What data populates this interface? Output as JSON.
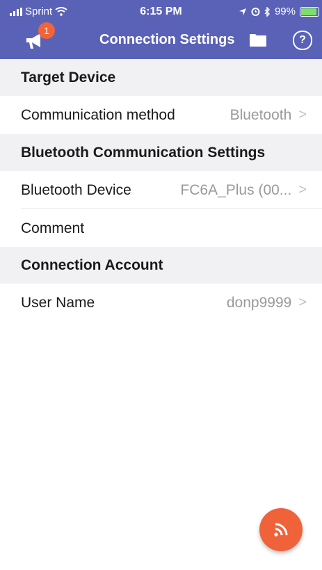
{
  "status_bar": {
    "carrier": "Sprint",
    "time": "6:15 PM",
    "battery": "99%"
  },
  "app_bar": {
    "title": "Connection Settings",
    "notification_count": "1",
    "help_label": "?"
  },
  "sections": {
    "target_device": {
      "header": "Target Device",
      "communication_method_label": "Communication method",
      "communication_method_value": "Bluetooth"
    },
    "bluetooth": {
      "header": "Bluetooth Communication Settings",
      "device_label": "Bluetooth Device",
      "device_value": "FC6A_Plus (00...",
      "comment_label": "Comment"
    },
    "account": {
      "header": "Connection Account",
      "user_name_label": "User Name",
      "user_name_value": "donp9999"
    }
  },
  "chevron": ">",
  "colors": {
    "app_bar": "#5a62b8",
    "accent": "#f0623a",
    "section_bg": "#f1f1f3",
    "value_text": "#9a9a9a"
  },
  "icons": [
    "megaphone-icon",
    "folder-icon",
    "help-icon",
    "wifi-icon",
    "signal-icon",
    "battery-icon",
    "broadcast-icon"
  ]
}
